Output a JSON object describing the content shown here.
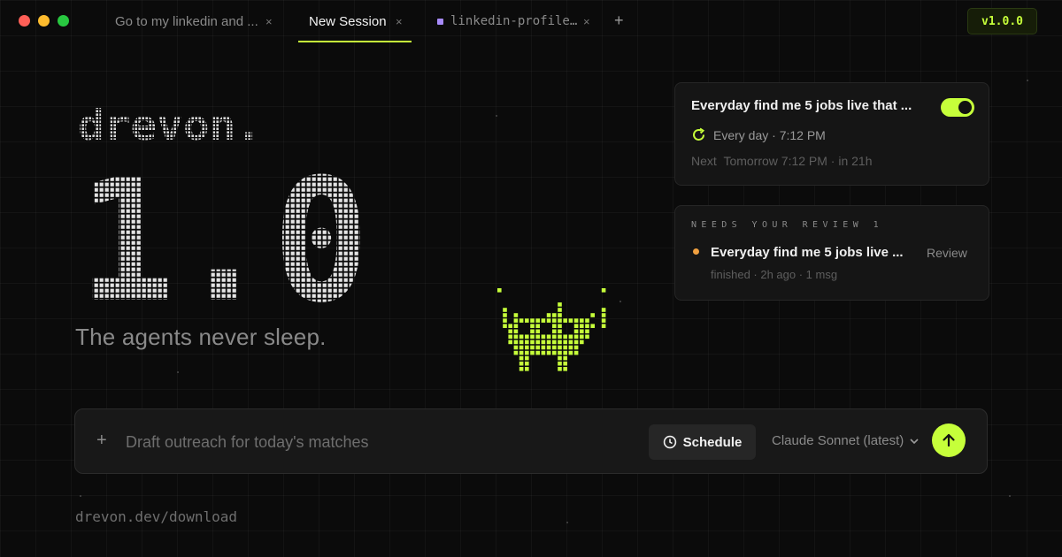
{
  "window": {
    "traffic_lights": [
      "#ff5f57",
      "#febc2e",
      "#28c840"
    ]
  },
  "tabs": [
    {
      "label": "Go to my linkedin and ...",
      "active": false
    },
    {
      "label": "New Session",
      "active": true
    },
    {
      "label": "linkedin-profile…",
      "active": false,
      "icon": "file-icon"
    }
  ],
  "tab_close_glyph": "×",
  "add_tab_glyph": "+",
  "version_badge": "v1.0.0",
  "hero": {
    "logo_text": "drevon.",
    "version_big": "1.0",
    "tagline": "The agents never sleep."
  },
  "schedule_card": {
    "title": "Everyday find me 5 jobs live that ...",
    "toggle_on": true,
    "schedule": "Every day · 7:12 PM",
    "next_label": "Next",
    "next_value": "Tomorrow 7:12 PM · in 21h",
    "repeat_icon": "repeat-icon"
  },
  "review_card": {
    "label": "NEEDS YOUR REVIEW",
    "count": "1",
    "item_title": "Everyday find me 5 jobs live ...",
    "item_action": "Review",
    "item_meta": "finished · 2h ago · 1 msg",
    "status_color": "#f0a040"
  },
  "composer": {
    "plus_glyph": "+",
    "placeholder": "Draft outreach for today's matches",
    "schedule_label": "Schedule",
    "model": "Claude Sonnet (latest)",
    "send_icon": "arrow-up-icon"
  },
  "footer_url": "drevon.dev/download",
  "colors": {
    "accent": "#c6ff3a",
    "background": "#0b0b0b",
    "card": "#151515"
  }
}
